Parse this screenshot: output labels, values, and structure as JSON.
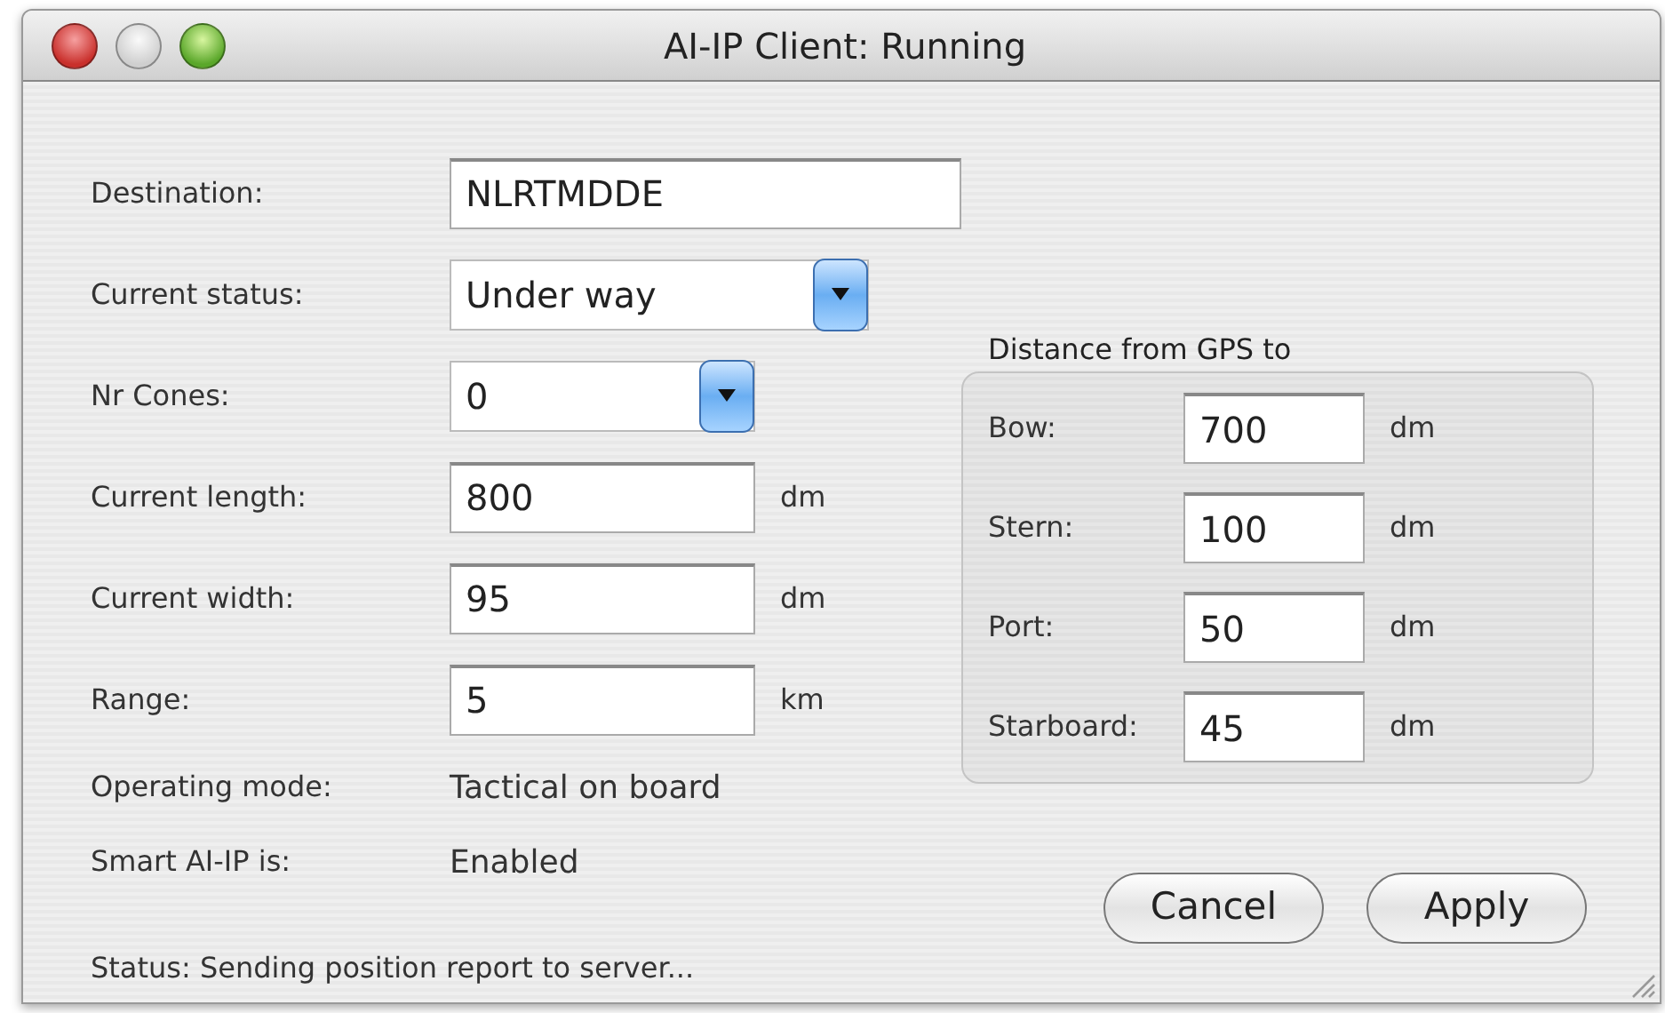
{
  "window": {
    "title": "AI-IP Client: Running"
  },
  "fields": [
    {
      "label": "Destination:",
      "kind": "text",
      "value": "NLRTMDDE"
    },
    {
      "label": "Current status:",
      "kind": "select",
      "value": "Under way"
    },
    {
      "label": "Nr Cones:",
      "kind": "select",
      "value": "0"
    },
    {
      "label": "Current length:",
      "kind": "text",
      "value": "800",
      "unit": "dm"
    },
    {
      "label": "Current width:",
      "kind": "text",
      "value": "95",
      "unit": "dm"
    },
    {
      "label": "Range:",
      "kind": "text",
      "value": "5",
      "unit": "km"
    },
    {
      "label": "Operating mode:",
      "kind": "info",
      "value": "Tactical on board"
    },
    {
      "label": "Smart AI-IP is:",
      "kind": "info",
      "value": "Enabled"
    }
  ],
  "gps_group": {
    "title": "Distance from GPS to",
    "fields": [
      {
        "label": "Bow:",
        "value": "700",
        "unit": "dm"
      },
      {
        "label": "Stern:",
        "value": "100",
        "unit": "dm"
      },
      {
        "label": "Port:",
        "value": "50",
        "unit": "dm"
      },
      {
        "label": "Starboard:",
        "value": "45",
        "unit": "dm"
      }
    ]
  },
  "buttons": [
    "Cancel",
    "Apply"
  ],
  "status_bar": "Status: Sending position report to server..."
}
